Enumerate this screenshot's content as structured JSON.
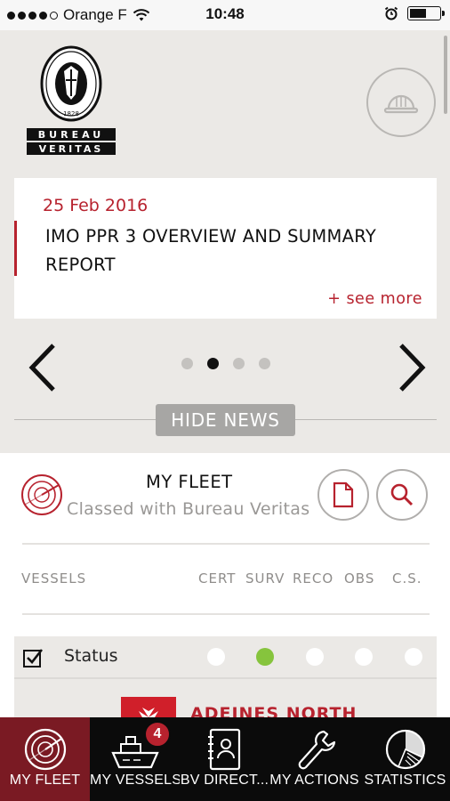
{
  "status_bar": {
    "carrier": "Orange F",
    "time": "10:48"
  },
  "news": {
    "date": "25 Feb 2016",
    "title": "IMO PPR 3 OVERVIEW AND SUMMARY REPORT",
    "see_more": "+ see more",
    "page_count": 4,
    "active_page": 2,
    "hide_label": "HIDE NEWS"
  },
  "logo": {
    "line1": "BUREAU",
    "line2": "VERITAS",
    "year": "1828"
  },
  "fleet": {
    "title": "MY FLEET",
    "subtitle": "Classed with Bureau Veritas"
  },
  "columns": {
    "vessels": "VESSELS",
    "cert": "CERT",
    "surv": "SURV",
    "reco": "RECO",
    "obs": "OBS",
    "cs": "C.S."
  },
  "status_row": {
    "label": "Status",
    "indicators": [
      "white",
      "green",
      "white",
      "white",
      "white"
    ]
  },
  "vessel": {
    "name": "ADEINES NORTH"
  },
  "tabs": [
    {
      "label": "MY FLEET",
      "icon": "radar-icon",
      "active": true
    },
    {
      "label": "MY VESSELS",
      "icon": "ship-icon",
      "badge": "4"
    },
    {
      "label": "BV DIRECT...",
      "icon": "contacts-book-icon"
    },
    {
      "label": "MY ACTIONS",
      "icon": "wrench-icon"
    },
    {
      "label": "STATISTICS",
      "icon": "pie-chart-icon"
    }
  ],
  "colors": {
    "brand_red": "#b7222e",
    "tab_active": "#7a1a23",
    "status_green": "#86c43d",
    "panel_grey": "#ebe9e6"
  }
}
